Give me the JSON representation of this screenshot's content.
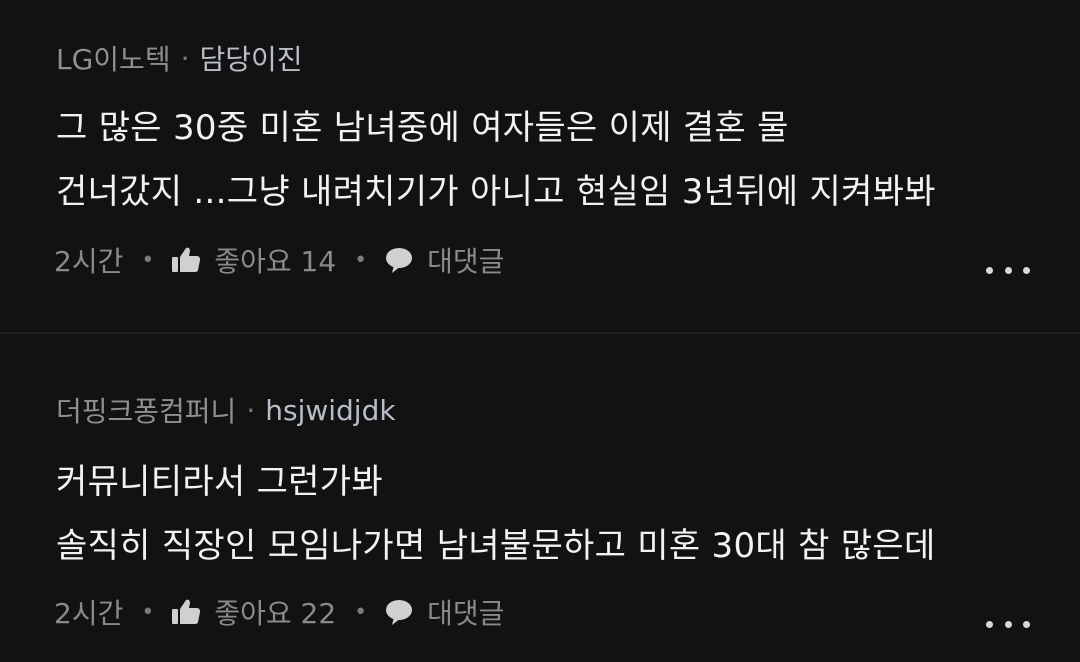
{
  "comments": [
    {
      "company": "LG이노텍",
      "author": "담당이진",
      "lines": [
        "그 많은 30중 미혼 남녀중에 여자들은 이제 결혼 물",
        "건너갔지 ...그냥 내려치기가 아니고 현실임 3년뒤에 지켜봐봐"
      ],
      "time": "2시간",
      "like_label": "좋아요 14",
      "reply_label": "대댓글"
    },
    {
      "company": "더핑크퐁컴퍼니",
      "author": "hsjwidjdk",
      "lines": [
        "커뮤니티라서 그런가봐",
        "솔직히 직장인 모임나가면 남녀불문하고 미혼 30대 참 많은데"
      ],
      "time": "2시간",
      "like_label": "좋아요 22",
      "reply_label": "대댓글"
    }
  ],
  "meta_separator": "·",
  "icons": {
    "like": "thumbs-up-icon",
    "reply": "speech-bubble-icon",
    "more": "more-dots-icon"
  },
  "colors": {
    "background": "#121212",
    "text": "#f2f2f2",
    "muted": "#8e8e93",
    "author": "#b8bec8"
  }
}
